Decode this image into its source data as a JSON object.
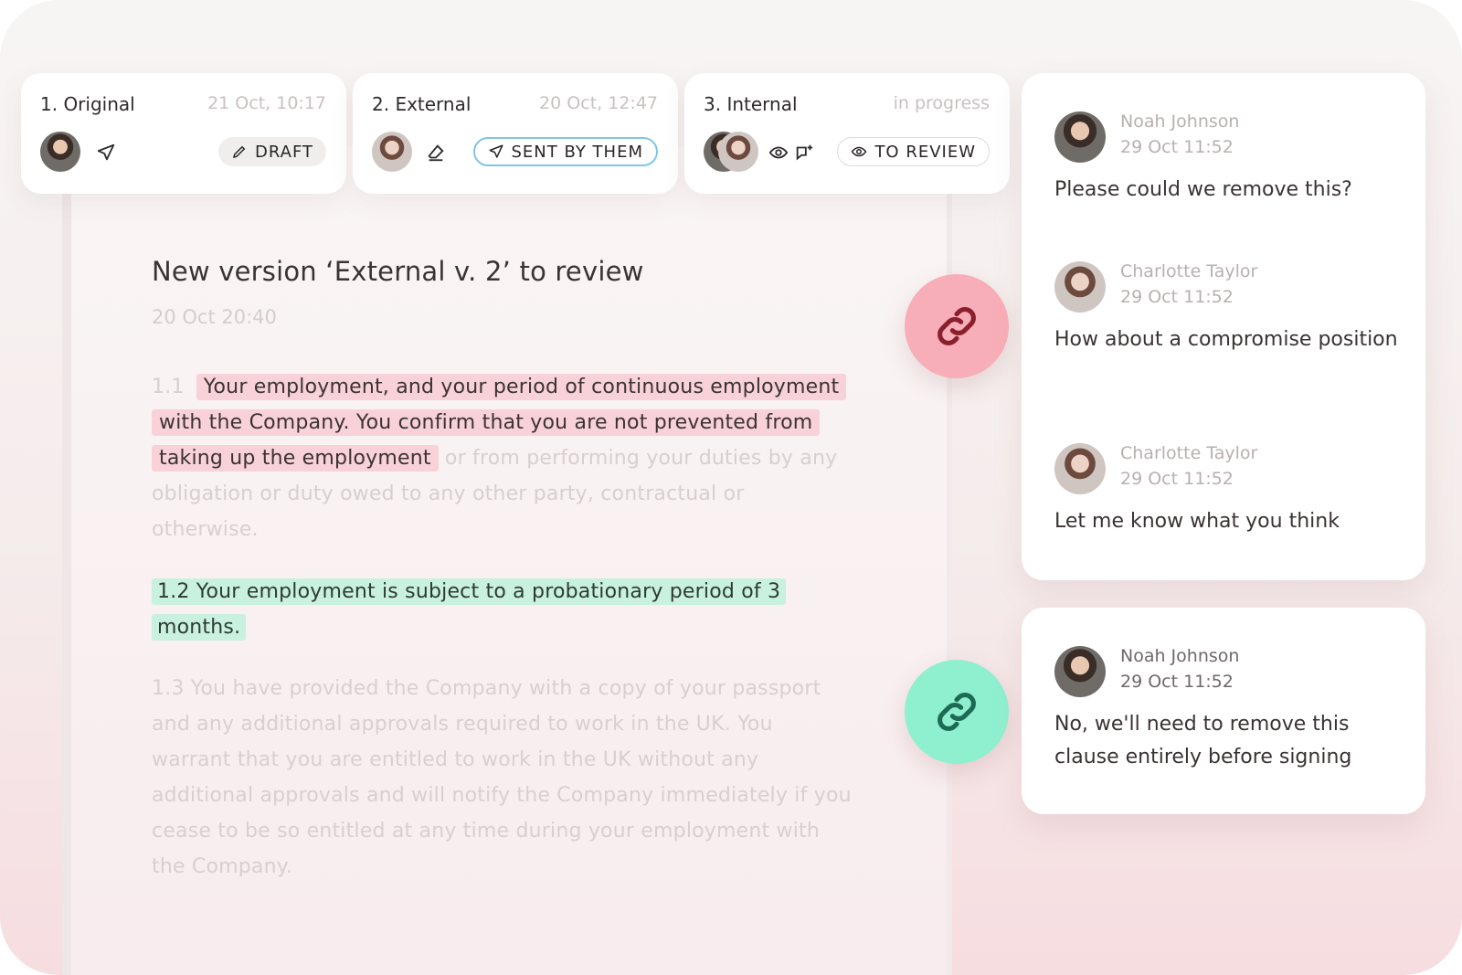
{
  "versions": [
    {
      "title": "1. Original",
      "time": "21 Oct, 10:17",
      "badge": "DRAFT"
    },
    {
      "title": "2. External",
      "time": "20 Oct, 12:47",
      "badge": "SENT BY THEM"
    },
    {
      "title": "3. Internal",
      "time": "in progress",
      "badge": "TO REVIEW"
    }
  ],
  "document": {
    "title": "New version ‘External v. 2’ to review",
    "date": "20 Oct 20:40",
    "p1_num": "1.1",
    "p1_highlight": "Your employment, and your period of continuous employment with the Company. You confirm that you are not prevented from taking up the employment",
    "p1_rest": " or from performing your duties by any obligation  or duty owed to any other party, contractual or otherwise.",
    "p2_highlight": "1.2 Your employment is subject to a probationary period of 3 months.",
    "p3": "1.3 You have provided the Company with a copy of your passport and any additional approvals required to work in the UK. You warrant that you are entitled to work in the UK without any additional approvals and will notify the Company immediately if you cease to be so entitled at any time during your employment with the Company."
  },
  "comments_thread_1": [
    {
      "name": "Noah Johnson",
      "date": "29 Oct 11:52",
      "text": "Please could we remove this?"
    },
    {
      "name": "Charlotte Taylor",
      "date": "29 Oct 11:52",
      "text": "How about a compromise position"
    },
    {
      "name": "Charlotte Taylor",
      "date": "29 Oct 11:52",
      "text": "Let me know what you think"
    }
  ],
  "comments_thread_2": [
    {
      "name": "Noah Johnson",
      "date": "29 Oct 11:52",
      "text": "No, we'll need to remove this clause entirely before signing"
    }
  ],
  "colors": {
    "highlight_red": "#f8d2d8",
    "highlight_green": "#c9f1df",
    "link_red": "#f8aeb8",
    "link_green": "#8ff0cf",
    "sent_border": "#7fc5e6"
  },
  "icons": {
    "send": "send-icon",
    "edit": "pencil-icon",
    "erase": "eraser-icon",
    "view": "eye-icon",
    "comment_add": "comment-add-icon",
    "link": "link-icon"
  }
}
